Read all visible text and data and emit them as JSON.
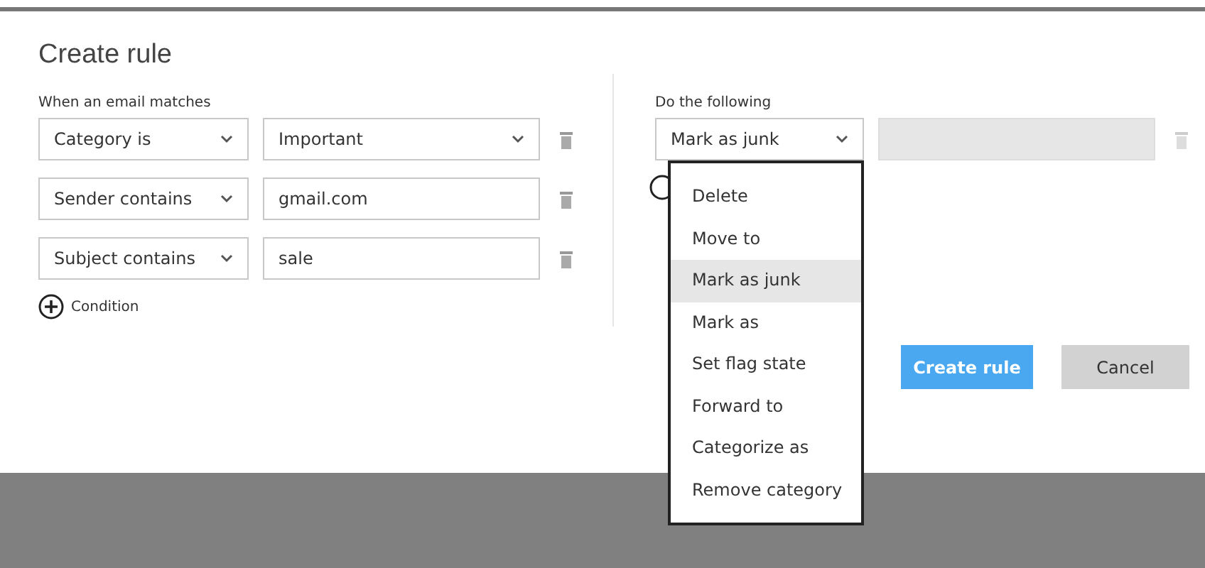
{
  "dialog": {
    "title": "Create rule",
    "conditions": {
      "label": "When an email matches",
      "rows": [
        {
          "field": "Category is",
          "value": "Important",
          "kind": "dropdown"
        },
        {
          "field": "Sender contains",
          "value": "gmail.com",
          "kind": "text"
        },
        {
          "field": "Subject contains",
          "value": "sale",
          "kind": "text"
        }
      ],
      "add_label": "Condition"
    },
    "actions": {
      "label": "Do the following",
      "action": "Mark as junk",
      "argument_disabled": true,
      "menu": [
        {
          "label": "Delete",
          "selected": false
        },
        {
          "label": "Move to",
          "selected": false
        },
        {
          "label": "Mark as junk",
          "selected": true
        },
        {
          "label": "Mark as",
          "selected": false
        },
        {
          "label": "Set flag state",
          "selected": false
        },
        {
          "label": "Forward to",
          "selected": false
        },
        {
          "label": "Categorize as",
          "selected": false
        },
        {
          "label": "Remove category",
          "selected": false
        }
      ]
    },
    "buttons": [
      {
        "label": "Create rule",
        "kind": "primary"
      },
      {
        "label": "Cancel",
        "kind": "secondary"
      }
    ]
  }
}
